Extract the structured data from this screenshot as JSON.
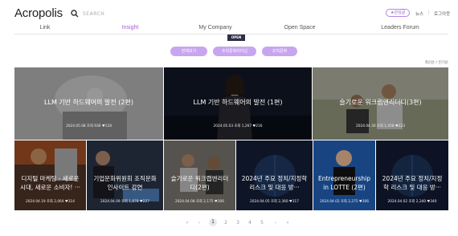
{
  "header": {
    "logo": "Acropolis",
    "search_placeholder": "SEARCH",
    "pill_label": "★관심글",
    "util_news": "뉴스",
    "util_sep": "|",
    "util_logout": "로그아웃"
  },
  "nav": {
    "items": [
      "Link",
      "Insight",
      "My Company",
      "Open Space",
      "Leaders Forum"
    ],
    "active": "Insight"
  },
  "open_badge": "OPEN",
  "filters": [
    "전체보기",
    "조직문화리더십",
    "조직문화"
  ],
  "sort": "최신순 / 인기순",
  "cards": [
    {
      "title": "LLM 기반 하드웨어의 발전 (2편)",
      "meta": "2024.05.08 조회 936 ♥118",
      "bg": "#cfcfcf"
    },
    {
      "title": "LLM 기반 하드웨어의 발전 (1편)",
      "meta": "2024.05.03 조회 1,267 ♥216",
      "bg": "#1d2233"
    },
    {
      "title": "슬기로운 워크랩앤리더디(3편)",
      "meta": "2024.04.30 조회 1,458 ♥223",
      "bg": "#8a8d77"
    },
    {
      "title": "디지털 마케팅 - 새로운 시대, 새로운 소비자! ···",
      "meta": "2024.04.19 조회 2,064 ♥314",
      "bg": "#5a3a2c"
    },
    {
      "title": "기업문화위원회 조직문화 인사이트 강연",
      "meta": "2024.04.09 조회 1,878 ♥227",
      "bg": "#3c4f6a"
    },
    {
      "title": "슬기로운 워크랩앤리더디(2편)",
      "meta": "2024.04.08 조회 2,175 ♥306",
      "bg": "#6f6a63"
    },
    {
      "title": "2024년 주요 정치/지정학 리스크 및 대응 방···",
      "meta": "2024.04.05 조회 2,360 ♥317",
      "bg": "#1e2c4e"
    },
    {
      "title": "Entrepreneurship in LOTTE (2편)",
      "meta": "2024.04.02 조회 2,275 ♥306",
      "bg": "#1f57a3"
    },
    {
      "title": "2024년 주요 정치/지정학 리스크 및 대응 방···",
      "meta": "2024.04.02 조회 2,340 ♥340",
      "bg": "#1c2a4a"
    }
  ],
  "pagination": {
    "first": "«",
    "prev": "‹",
    "pages": [
      "1",
      "2",
      "3",
      "4",
      "5"
    ],
    "current": "1",
    "next": "›",
    "last": "»"
  },
  "colors": {
    "accent": "#a35fd4",
    "filter_bg": "#c7a6ef",
    "badge_bg": "#2e2e4a"
  }
}
